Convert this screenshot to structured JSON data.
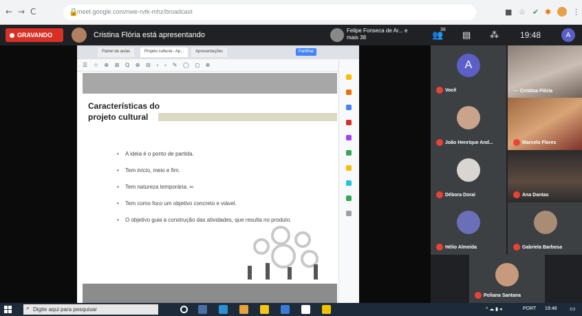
{
  "browser": {
    "url": "meet.google.com/nwe-rvtk-mhz/broadcast",
    "back": "←",
    "forward": "→",
    "reload": "C"
  },
  "meet": {
    "recording_label": "GRAVANDO",
    "presenting_text": "Cristina Flória está apresentando",
    "others_text": "Felipe Fonseca de Ar... e mais 38",
    "people_count": "38",
    "clock": "19:48",
    "self_initial": "A"
  },
  "shared": {
    "tabs": [
      "Painel de aulas",
      "Projeto cultural - Ap...",
      "Apresentações"
    ],
    "share_label": "Partilhar",
    "toolbar_icons": "☰ ☆ ⊕ ⊞ Q ⊕ ⊟ ‹ › ✎ ◯ ◻ ⊗",
    "slide_title_line1": "Características do",
    "slide_title_line2": "projeto cultural",
    "bullets": [
      "A ideia é o ponto de partida.",
      "Tem início, meio e fim.",
      "Tem natureza temporária. ∞",
      "Tem como foco um objetivo concreto e viável.",
      "O objetivo guia a construção das atividades, que resulta no produto."
    ]
  },
  "participants": [
    {
      "name": "Você",
      "initial": "A",
      "kind": "avatar",
      "color": "#5b5fc7"
    },
    {
      "name": "Cristina Flória",
      "kind": "video"
    },
    {
      "name": "João Henrique And...",
      "kind": "photo"
    },
    {
      "name": "Marcelo Flores",
      "kind": "video"
    },
    {
      "name": "Débora Dorai",
      "kind": "photo"
    },
    {
      "name": "Ana Dantas",
      "kind": "video"
    },
    {
      "name": "Hélio Almeida",
      "kind": "photo"
    },
    {
      "name": "Gabriela Barbosa",
      "kind": "photo"
    },
    {
      "name": "Poliana Santana",
      "kind": "photo"
    }
  ],
  "taskbar": {
    "search_placeholder": "Digite aqui para pesquisar",
    "tray_text": "PORT",
    "time": "19:48"
  },
  "colors": {
    "record_red": "#d93025",
    "meet_bg": "#202124",
    "tile_bg": "#3c4043",
    "mic_off": "#ea4335",
    "self_avatar": "#5b5fc7"
  }
}
